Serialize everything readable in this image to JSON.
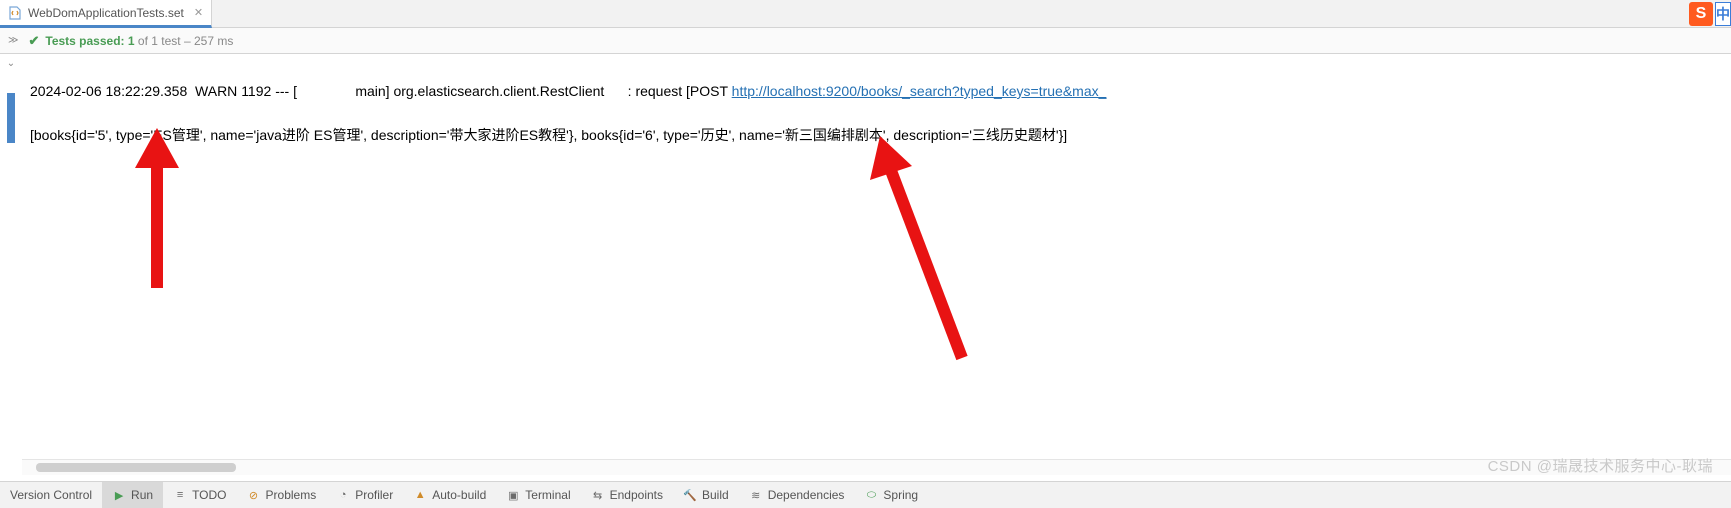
{
  "tab": {
    "filename": "WebDomApplicationTests.set",
    "icon_name": "file-icon"
  },
  "status": {
    "passed_label": "Tests passed:",
    "passed_count": "1",
    "of_total": "of 1 test",
    "dash": "–",
    "duration": "257 ms"
  },
  "console": {
    "line1": {
      "timestamp": "2024-02-06 18:22:29.358",
      "level": "WARN",
      "pid": "1192",
      "sep": "---",
      "thread": "[               main]",
      "logger": "org.elasticsearch.client.RestClient",
      "colon": ":",
      "msg_prefix": "request [POST ",
      "url": "http://localhost:9200/books/_search?typed_keys=true&max_"
    },
    "line2": "[books{id='5', type='ES管理', name='java进阶 ES管理', description='带大家进阶ES教程'}, books{id='6', type='历史', name='新三国编排剧本', description='三线历史题材'}]"
  },
  "toolbar": {
    "version_control": "Version Control",
    "run": "Run",
    "todo": "TODO",
    "problems": "Problems",
    "profiler": "Profiler",
    "auto_build": "Auto-build",
    "terminal": "Terminal",
    "endpoints": "Endpoints",
    "build": "Build",
    "dependencies": "Dependencies",
    "spring": "Spring"
  },
  "watermark": "CSDN @瑞晟技术服务中心-耿瑞",
  "badges": {
    "sogou": "S",
    "cn": "中"
  }
}
